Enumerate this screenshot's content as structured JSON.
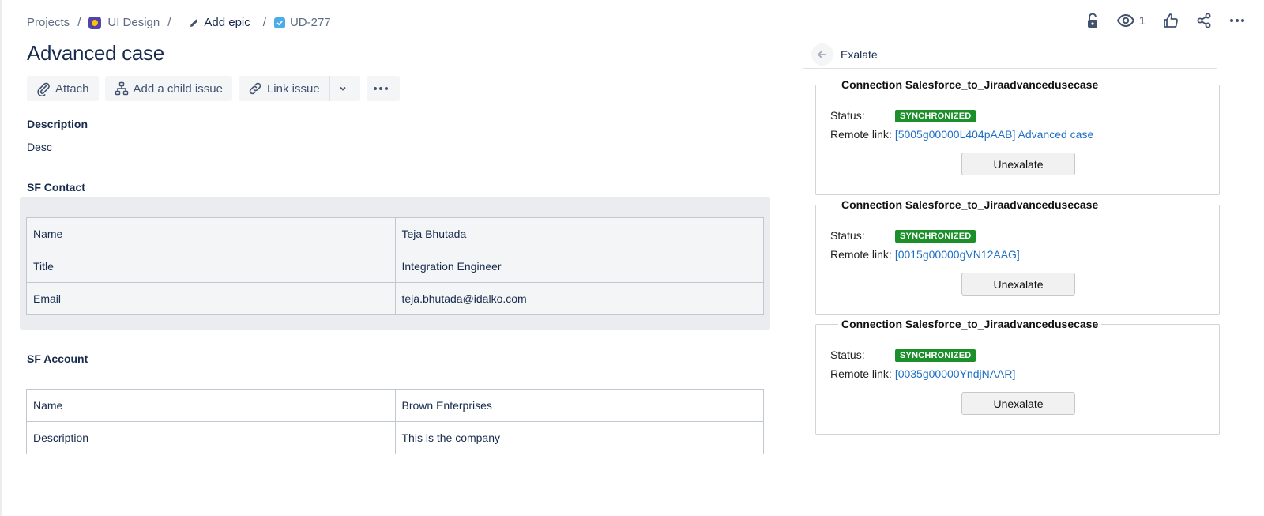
{
  "breadcrumb": {
    "projects": "Projects",
    "project": "UI Design",
    "epic": "Add epic",
    "issue_key": "UD-277",
    "separator": "/"
  },
  "top_actions": {
    "watch_count": "1",
    "icons": [
      "unlock-icon",
      "eye-icon",
      "thumbs-up-icon",
      "share-icon",
      "more-icon"
    ]
  },
  "issue": {
    "title": "Advanced case"
  },
  "toolbar": {
    "attach": "Attach",
    "add_child": "Add a child issue",
    "link_issue": "Link issue"
  },
  "description": {
    "label": "Description",
    "text": "Desc"
  },
  "sf_contact": {
    "label": "SF Contact",
    "rows": [
      {
        "key": "Name",
        "value": "Teja Bhutada"
      },
      {
        "key": "Title",
        "value": "Integration Engineer"
      },
      {
        "key": "Email",
        "value": "teja.bhutada@idalko.com"
      }
    ]
  },
  "sf_account": {
    "label": "SF Account",
    "rows": [
      {
        "key": "Name",
        "value": "Brown Enterprises"
      },
      {
        "key": "Description",
        "value": "This is the company"
      }
    ]
  },
  "panel": {
    "title": "Exalate",
    "connections": [
      {
        "name": "Connection Salesforce_to_Jiraadvancedusecase",
        "status_label": "Status:",
        "status": "SYNCHRONIZED",
        "remote_label": "Remote link:",
        "remote_link": "[5005g00000L404pAAB] Advanced case",
        "button": "Unexalate"
      },
      {
        "name": "Connection Salesforce_to_Jiraadvancedusecase",
        "status_label": "Status:",
        "status": "SYNCHRONIZED",
        "remote_label": "Remote link:",
        "remote_link": "[0015g00000gVN12AAG]",
        "button": "Unexalate"
      },
      {
        "name": "Connection Salesforce_to_Jiraadvancedusecase",
        "status_label": "Status:",
        "status": "SYNCHRONIZED",
        "remote_label": "Remote link:",
        "remote_link": "[0035g00000YndjNAAR]",
        "button": "Unexalate"
      }
    ]
  },
  "colors": {
    "status_green": "#1a8f2a",
    "link_blue": "#1f6fc5",
    "text_primary": "#172b4d",
    "table_bg_gray": "#ebecf0"
  }
}
